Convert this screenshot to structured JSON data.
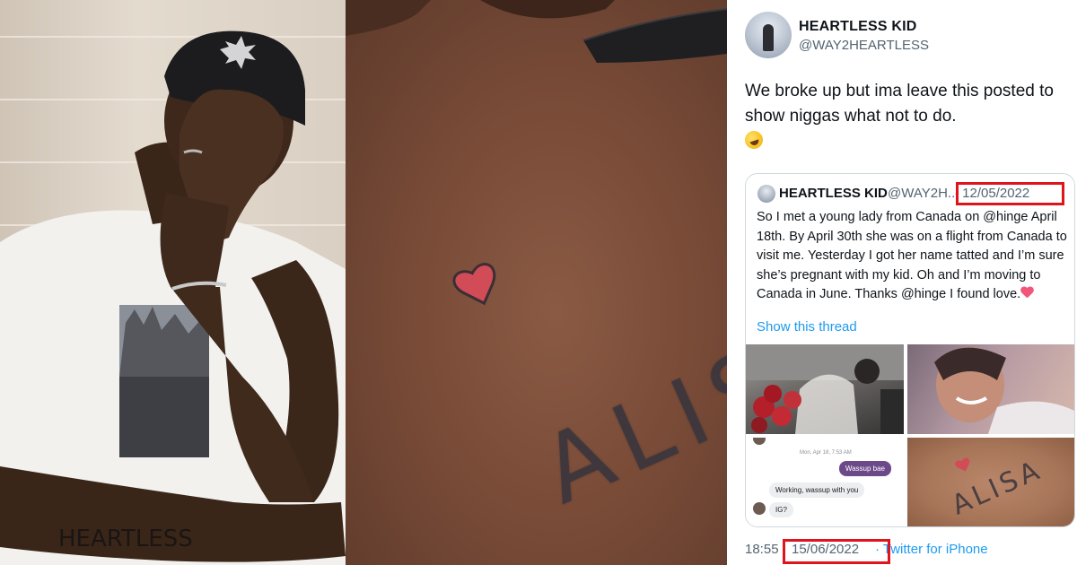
{
  "tweet": {
    "author_name": "HEARTLESS KID",
    "author_handle": "@WAY2HEARTLESS",
    "text": "We broke up but ima leave this posted to show niggas what not to do.",
    "text_emoji": "rolling-on-floor-laughing-emoji",
    "quoted": {
      "author_name": "HEARTLESS KID",
      "author_handle": "@WAY2H...",
      "date": "· 12/05/2022",
      "text": "So I met a young lady from Canada on @hinge April 18th. By April 30th she was on a flight from Canada to visit me. Yesterday I got her name tatted and I’m sure she’s pregnant with my kid. Oh and I’m moving to Canada in June. Thanks @hinge I found love.",
      "text_emoji": "heart-with-arrow-emoji",
      "show_thread": "Show this thread",
      "chat": {
        "day": "Mon, Apr 18, 7:53 AM",
        "outgoing": "Wassup bae",
        "incoming_1": "Working, wassup with you",
        "incoming_2": "IG?"
      },
      "tattoo_text": "ALISA"
    },
    "time": "18:55",
    "date": "15/06/2022",
    "source": "· Twitter for iPhone"
  },
  "left_photo": {
    "forearm_tattoo": "HEARTLESS"
  },
  "mid_photo": {
    "tattoo_text": "ALISA"
  },
  "colors": {
    "link": "#1d9bf0",
    "secondary_text": "#536471",
    "highlight_box": "#e0141c"
  }
}
